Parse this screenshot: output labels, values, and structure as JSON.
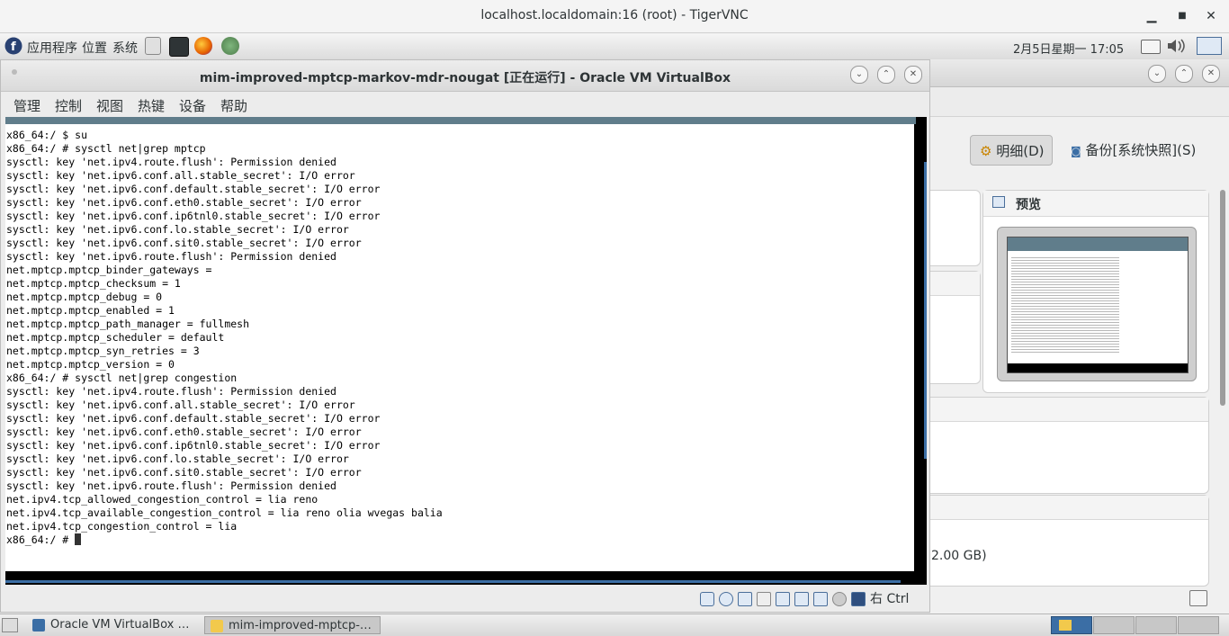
{
  "vnc": {
    "title": "localhost.localdomain:16 (root) - TigerVNC",
    "minimize": "▁",
    "maximize": "■",
    "close": "✕"
  },
  "panel": {
    "menus": [
      "应用程序",
      "位置",
      "系统"
    ],
    "clock": "2月5日星期一 17:05"
  },
  "vm_window": {
    "title": "mim-improved-mptcp-markov-mdr-nougat [正在运行] - Oracle VM VirtualBox",
    "menu": [
      "管理",
      "控制",
      "视图",
      "热键",
      "设备",
      "帮助"
    ],
    "host_key": "右 Ctrl"
  },
  "terminal": {
    "lines": [
      "x86_64:/ $ su",
      "x86_64:/ # sysctl net|grep mptcp",
      "sysctl: key 'net.ipv4.route.flush': Permission denied",
      "sysctl: key 'net.ipv6.conf.all.stable_secret': I/O error",
      "sysctl: key 'net.ipv6.conf.default.stable_secret': I/O error",
      "sysctl: key 'net.ipv6.conf.eth0.stable_secret': I/O error",
      "sysctl: key 'net.ipv6.conf.ip6tnl0.stable_secret': I/O error",
      "sysctl: key 'net.ipv6.conf.lo.stable_secret': I/O error",
      "sysctl: key 'net.ipv6.conf.sit0.stable_secret': I/O error",
      "sysctl: key 'net.ipv6.route.flush': Permission denied",
      "net.mptcp.mptcp_binder_gateways =",
      "net.mptcp.mptcp_checksum = 1",
      "net.mptcp.mptcp_debug = 0",
      "net.mptcp.mptcp_enabled = 1",
      "net.mptcp.mptcp_path_manager = fullmesh",
      "net.mptcp.mptcp_scheduler = default",
      "net.mptcp.mptcp_syn_retries = 3",
      "net.mptcp.mptcp_version = 0",
      "x86_64:/ # sysctl net|grep congestion",
      "sysctl: key 'net.ipv4.route.flush': Permission denied",
      "sysctl: key 'net.ipv6.conf.all.stable_secret': I/O error",
      "sysctl: key 'net.ipv6.conf.default.stable_secret': I/O error",
      "sysctl: key 'net.ipv6.conf.eth0.stable_secret': I/O error",
      "sysctl: key 'net.ipv6.conf.ip6tnl0.stable_secret': I/O error",
      "sysctl: key 'net.ipv6.conf.lo.stable_secret': I/O error",
      "sysctl: key 'net.ipv6.conf.sit0.stable_secret': I/O error",
      "sysctl: key 'net.ipv6.route.flush': Permission denied",
      "net.ipv4.tcp_allowed_congestion_control = lia reno",
      "net.ipv4.tcp_available_congestion_control = lia reno olia wvegas balia",
      "net.ipv4.tcp_congestion_control = lia"
    ],
    "prompt": "x86_64:/ # "
  },
  "manager": {
    "details_label": "明细(D)",
    "snapshot_label": "备份[系统快照](S)",
    "preview_title": "预览",
    "storage_size": "2.00 GB)"
  },
  "taskbar": {
    "items": [
      "Oracle VM VirtualBox …",
      "mim-improved-mptcp-…"
    ]
  },
  "colors": {
    "accent": "#3b6ea5",
    "android_bar": "#607d8b"
  }
}
